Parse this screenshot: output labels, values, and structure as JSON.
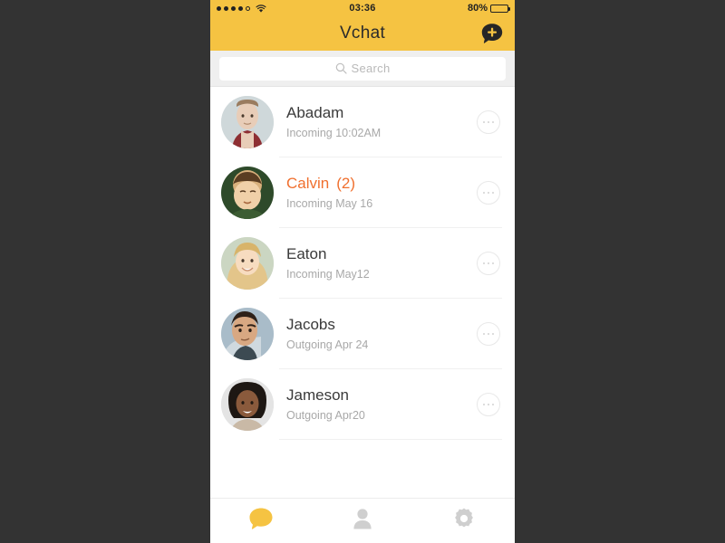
{
  "statusbar": {
    "signal_dots_filled": 4,
    "signal_dots_total": 5,
    "wifi_icon": "wifi-icon",
    "time": "03:36",
    "battery_percent": "80%",
    "battery_level": 80
  },
  "navbar": {
    "title": "Vchat",
    "add_button_icon": "chat-bubble-plus-icon",
    "background_color": "#F5C342"
  },
  "search": {
    "placeholder": "Search",
    "icon": "search-icon",
    "value": ""
  },
  "list": {
    "more_icon": "ellipsis-icon",
    "items": [
      {
        "name": "Abadam",
        "status": "Incoming 10:02AM",
        "unread": false,
        "count": "",
        "avatar": "avatar-abadam"
      },
      {
        "name": "Calvin",
        "status": "Incoming  May 16",
        "unread": true,
        "count": "(2)",
        "avatar": "avatar-calvin"
      },
      {
        "name": "Eaton",
        "status": "Incoming  May12",
        "unread": false,
        "count": "",
        "avatar": "avatar-eaton"
      },
      {
        "name": "Jacobs",
        "status": "Outgoing Apr 24",
        "unread": false,
        "count": "",
        "avatar": "avatar-jacobs"
      },
      {
        "name": "Jameson",
        "status": "Outgoing Apr20",
        "unread": false,
        "count": "",
        "avatar": "avatar-jameson"
      }
    ]
  },
  "tabbar": {
    "tabs": [
      {
        "name": "chats",
        "icon": "chat-bubble-icon",
        "active": true
      },
      {
        "name": "contacts",
        "icon": "person-icon",
        "active": false
      },
      {
        "name": "settings",
        "icon": "gear-icon",
        "active": false
      }
    ],
    "active_color": "#F5C342",
    "inactive_color": "#CFCFCF"
  },
  "colors": {
    "accent_yellow": "#F5C342",
    "unread_orange": "#F0702F",
    "backdrop": "#333333"
  }
}
